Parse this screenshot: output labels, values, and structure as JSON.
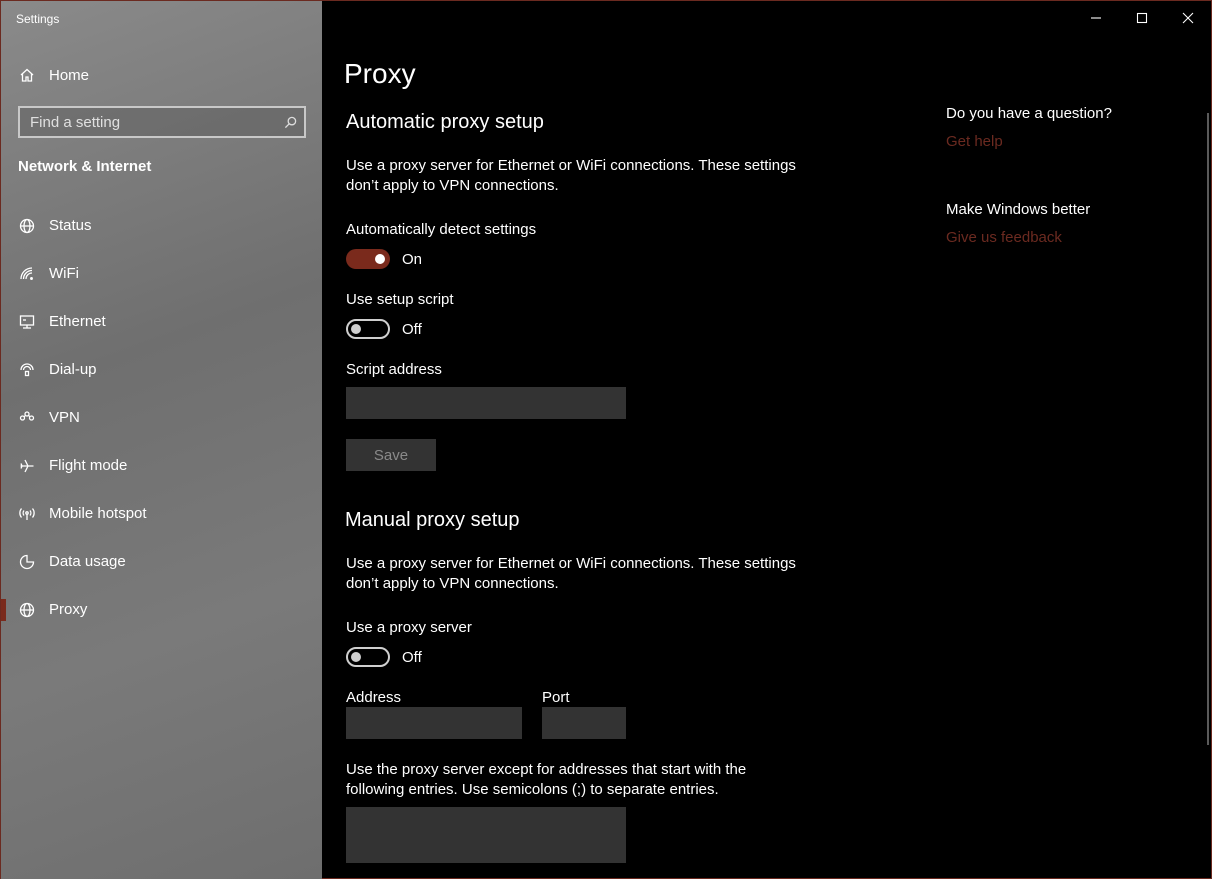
{
  "window": {
    "title": "Settings"
  },
  "sidebar": {
    "home_label": "Home",
    "search_placeholder": "Find a setting",
    "section_title": "Network & Internet",
    "items": [
      {
        "label": "Status",
        "icon": "globe-icon"
      },
      {
        "label": "WiFi",
        "icon": "wifi-icon"
      },
      {
        "label": "Ethernet",
        "icon": "ethernet-icon"
      },
      {
        "label": "Dial-up",
        "icon": "dialup-icon"
      },
      {
        "label": "VPN",
        "icon": "vpn-icon"
      },
      {
        "label": "Flight mode",
        "icon": "airplane-icon"
      },
      {
        "label": "Mobile hotspot",
        "icon": "hotspot-icon"
      },
      {
        "label": "Data usage",
        "icon": "data-usage-icon"
      },
      {
        "label": "Proxy",
        "icon": "globe-icon",
        "selected": true
      }
    ]
  },
  "main": {
    "page_title": "Proxy",
    "auto": {
      "heading": "Automatic proxy setup",
      "description_line1": "Use a proxy server for Ethernet or WiFi connections. These settings",
      "description_line2": "don’t apply to VPN connections.",
      "detect_label": "Automatically detect settings",
      "detect_state": "On",
      "script_label": "Use setup script",
      "script_state": "Off",
      "script_address_label": "Script address",
      "script_address_value": "",
      "save_label": "Save"
    },
    "manual": {
      "heading": "Manual proxy setup",
      "description_line1": "Use a proxy server for Ethernet or WiFi connections. These settings",
      "description_line2": "don’t apply to VPN connections.",
      "use_proxy_label": "Use a proxy server",
      "use_proxy_state": "Off",
      "address_label": "Address",
      "address_value": "",
      "port_label": "Port",
      "port_value": "",
      "exceptions_line1": "Use the proxy server except for addresses that start with the",
      "exceptions_line2": "following entries. Use semicolons (;) to separate entries.",
      "exceptions_value": ""
    }
  },
  "aside": {
    "question_heading": "Do you have a question?",
    "get_help_link": "Get help",
    "better_heading": "Make Windows better",
    "feedback_link": "Give us feedback"
  },
  "colors": {
    "accent": "#7a2a1c",
    "link": "#6b2a20",
    "textbox_bg": "#333333"
  }
}
